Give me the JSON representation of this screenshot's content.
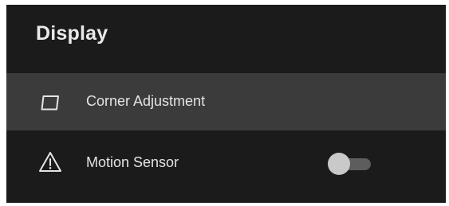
{
  "header": {
    "title": "Display"
  },
  "menu": {
    "items": [
      {
        "label": "Corner Adjustment",
        "icon": "corner-adjustment-icon",
        "selected": true
      },
      {
        "label": "Motion Sensor",
        "icon": "warning-icon",
        "toggle": {
          "state": "off"
        }
      }
    ]
  },
  "colors": {
    "background": "#1b1b1b",
    "selected_row": "#3b3b3b",
    "text": "#e4e4e4",
    "toggle_track": "#5d5d5d",
    "toggle_knob": "#c9c9c9"
  }
}
